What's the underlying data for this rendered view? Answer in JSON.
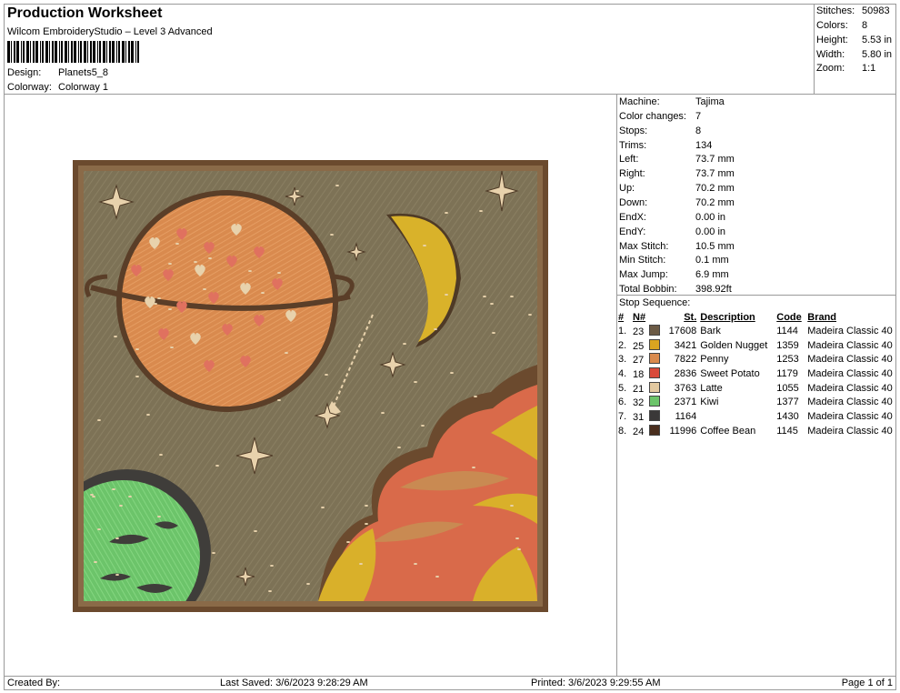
{
  "header": {
    "title": "Production Worksheet",
    "software": "Wilcom EmbroideryStudio – Level 3 Advanced",
    "design_label": "Design:",
    "design_value": "Planets5_8",
    "colorway_label": "Colorway:",
    "colorway_value": "Colorway 1"
  },
  "stats": [
    {
      "label": "Stitches:",
      "value": "50983"
    },
    {
      "label": "Colors:",
      "value": "8"
    },
    {
      "label": "Height:",
      "value": "5.53 in"
    },
    {
      "label": "Width:",
      "value": "5.80 in"
    },
    {
      "label": "Zoom:",
      "value": "1:1"
    }
  ],
  "machine": [
    {
      "label": "Machine:",
      "value": "Tajima"
    },
    {
      "label": "Color changes:",
      "value": "7"
    },
    {
      "label": "Stops:",
      "value": "8"
    },
    {
      "label": "Trims:",
      "value": "134"
    },
    {
      "label": "Left:",
      "value": "73.7 mm"
    },
    {
      "label": "Right:",
      "value": "73.7 mm"
    },
    {
      "label": "Up:",
      "value": "70.2 mm"
    },
    {
      "label": "Down:",
      "value": "70.2 mm"
    },
    {
      "label": "EndX:",
      "value": "0.00 in"
    },
    {
      "label": "EndY:",
      "value": "0.00 in"
    },
    {
      "label": "Max Stitch:",
      "value": "10.5 mm"
    },
    {
      "label": "Min Stitch:",
      "value": "0.1 mm"
    },
    {
      "label": "Max Jump:",
      "value": "6.9 mm"
    },
    {
      "label": "Total Bobbin:",
      "value": "398.92ft"
    }
  ],
  "stop_sequence": {
    "title": "Stop Sequence:",
    "headers": [
      "#",
      "N#",
      "St.",
      "Description",
      "Code",
      "Brand"
    ],
    "rows": [
      {
        "num": "1.",
        "n": "23",
        "color": "#6b5a45",
        "st": "17608",
        "desc": "Bark",
        "code": "1144",
        "brand": "Madeira Classic 40"
      },
      {
        "num": "2.",
        "n": "25",
        "color": "#d9a520",
        "st": "3421",
        "desc": "Golden Nugget",
        "code": "1359",
        "brand": "Madeira Classic 40"
      },
      {
        "num": "3.",
        "n": "27",
        "color": "#d98a4e",
        "st": "7822",
        "desc": "Penny",
        "code": "1253",
        "brand": "Madeira Classic 40"
      },
      {
        "num": "4.",
        "n": "18",
        "color": "#d94a3a",
        "st": "2836",
        "desc": "Sweet Potato",
        "code": "1179",
        "brand": "Madeira Classic 40"
      },
      {
        "num": "5.",
        "n": "21",
        "color": "#e3c9a0",
        "st": "3763",
        "desc": "Latte",
        "code": "1055",
        "brand": "Madeira Classic 40"
      },
      {
        "num": "6.",
        "n": "32",
        "color": "#6cc46a",
        "st": "2371",
        "desc": "Kiwi",
        "code": "1377",
        "brand": "Madeira Classic 40"
      },
      {
        "num": "7.",
        "n": "31",
        "color": "#3a3838",
        "st": "1164",
        "desc": "",
        "code": "1430",
        "brand": "Madeira Classic 40"
      },
      {
        "num": "8.",
        "n": "24",
        "color": "#4a2e1e",
        "st": "11996",
        "desc": "Coffee Bean",
        "code": "1145",
        "brand": "Madeira Classic 40"
      }
    ]
  },
  "footer": {
    "created_by": "Created By:",
    "last_saved": "Last Saved: 3/6/2023 9:28:29 AM",
    "printed": "Printed: 3/6/2023 9:29:55 AM",
    "page": "Page 1 of 1"
  },
  "colors": {
    "background": "#7d7256",
    "border": "#6b4a2e",
    "planet_orange": "#d98a4e",
    "planet_green": "#6cc46a",
    "moon": "#d9b22a",
    "hearts": "#e0715f",
    "hearts_light": "#e8d2ac",
    "clouds_red": "#d96a4a",
    "clouds_gold": "#d9b02a"
  }
}
